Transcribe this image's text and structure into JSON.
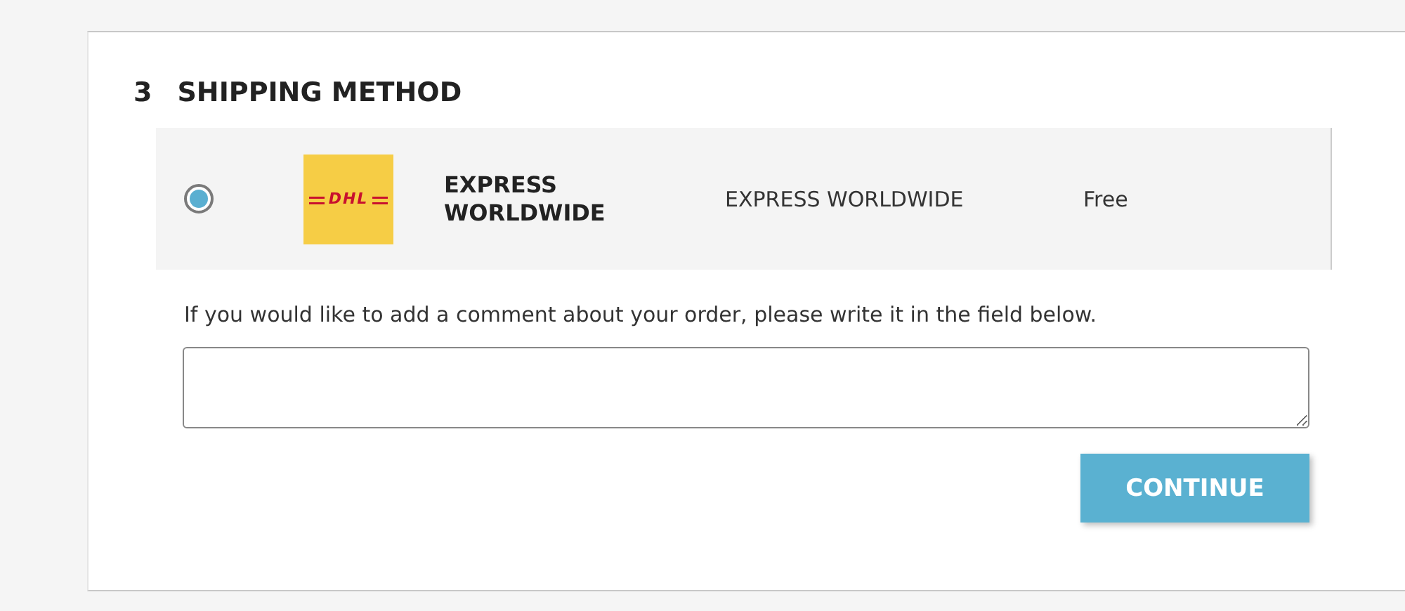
{
  "section": {
    "number": "3",
    "title": "SHIPPING METHOD"
  },
  "options": [
    {
      "selected": true,
      "logo": "DHL",
      "name": "EXPRESS WORLDWIDE",
      "description": "EXPRESS WORLDWIDE",
      "price": "Free"
    }
  ],
  "comment": {
    "label": "If you would like to add a comment about your order, please write it in the field below."
  },
  "buttons": [
    "CONTINUE"
  ]
}
